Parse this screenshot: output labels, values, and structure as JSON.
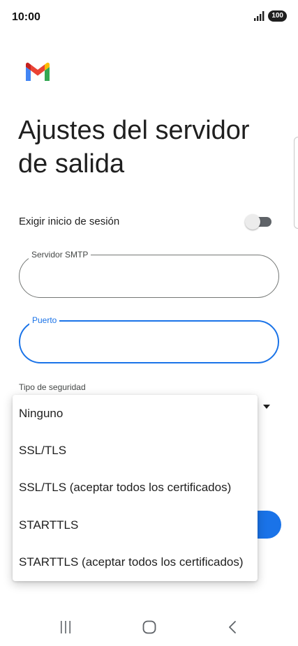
{
  "status_bar": {
    "time": "10:00",
    "battery": "100",
    "signal_icon": "signal-bars-icon"
  },
  "app": {
    "logo_icon": "gmail-logo-icon",
    "brand_colors": {
      "blue": "#4285F4",
      "red": "#EA4335",
      "yellow": "#FBBC04",
      "green": "#34A853",
      "dark_red": "#C5221F"
    }
  },
  "page": {
    "title": "Ajustes del servidor de salida"
  },
  "signin": {
    "label": "Exigir inicio de sesión",
    "enabled": false
  },
  "fields": {
    "smtp": {
      "label": "Servidor SMTP",
      "value": ""
    },
    "port": {
      "label": "Puerto",
      "value": ""
    }
  },
  "security": {
    "label": "Tipo de seguridad",
    "options": [
      "Ninguno",
      "SSL/TLS",
      "SSL/TLS (aceptar todos los certificados)",
      "STARTTLS",
      "STARTTLS (aceptar todos los certificados)"
    ]
  },
  "colors": {
    "accent": "#1a73e8",
    "text": "#1f1f1f",
    "outline": "#747775"
  },
  "nav": {
    "recents_icon": "recents-icon",
    "home_icon": "home-icon",
    "back_icon": "back-icon"
  }
}
